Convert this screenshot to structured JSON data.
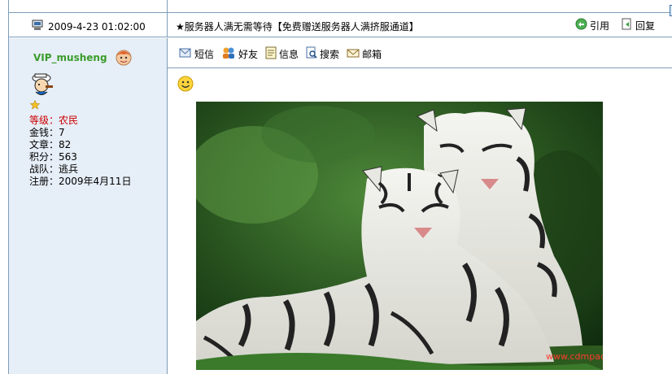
{
  "post": {
    "time": "2009-4-23 01:02:00",
    "title": "★服务器人满无需等待【免费赠送服务器人满挤服通道】",
    "quote_label": "引用",
    "reply_label": "回复"
  },
  "user": {
    "name": "VIP_musheng",
    "level_label": "等级：",
    "level_value": "农民",
    "money": "金钱：7",
    "articles": "文章：82",
    "points": "积分：563",
    "team": "战队：逃兵",
    "registered": "注册：2009年4月11日"
  },
  "toolbar": {
    "message": "短信",
    "friend": "好友",
    "info": "信息",
    "search": "搜索",
    "mail": "邮箱"
  },
  "image": {
    "watermark": "www.cdmpack.com"
  },
  "colors": {
    "border": "#7f9db9",
    "sidebar_bg": "#e6eef7",
    "username": "#3a9c2a",
    "level": "#cc0000"
  }
}
